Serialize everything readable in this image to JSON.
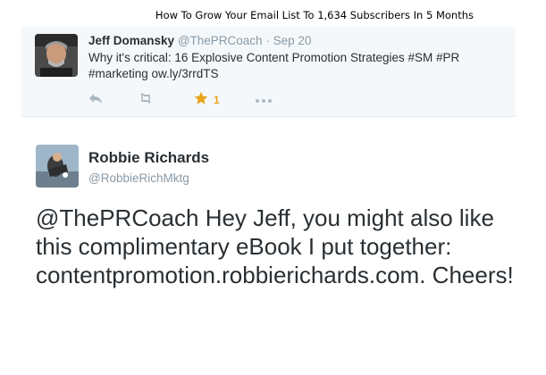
{
  "caption": "How To Grow Your Email List To 1,634 Subscribers In 5 Months",
  "parent_tweet": {
    "fullname": "Jeff Domansky",
    "handle": "@ThePRCoach",
    "separator": "·",
    "date": "Sep 20",
    "text": "Why it's critical: 16 Explosive Content Promotion Strategies #SM #PR #marketing ow.ly/3rrdTS",
    "favorite_count": "1",
    "icons": [
      "reply-icon",
      "retweet-icon",
      "favorite-star-icon",
      "more-icon"
    ],
    "colors": {
      "favorite": "#e8a319",
      "muted": "#8899a6",
      "background": "#f5f8fa"
    }
  },
  "main_tweet": {
    "fullname": "Robbie Richards",
    "handle": "@RobbieRichMktg",
    "text": "@ThePRCoach Hey Jeff, you might also like this complimentary eBook I put together: contentpromotion.robbierichards.com. Cheers!"
  }
}
